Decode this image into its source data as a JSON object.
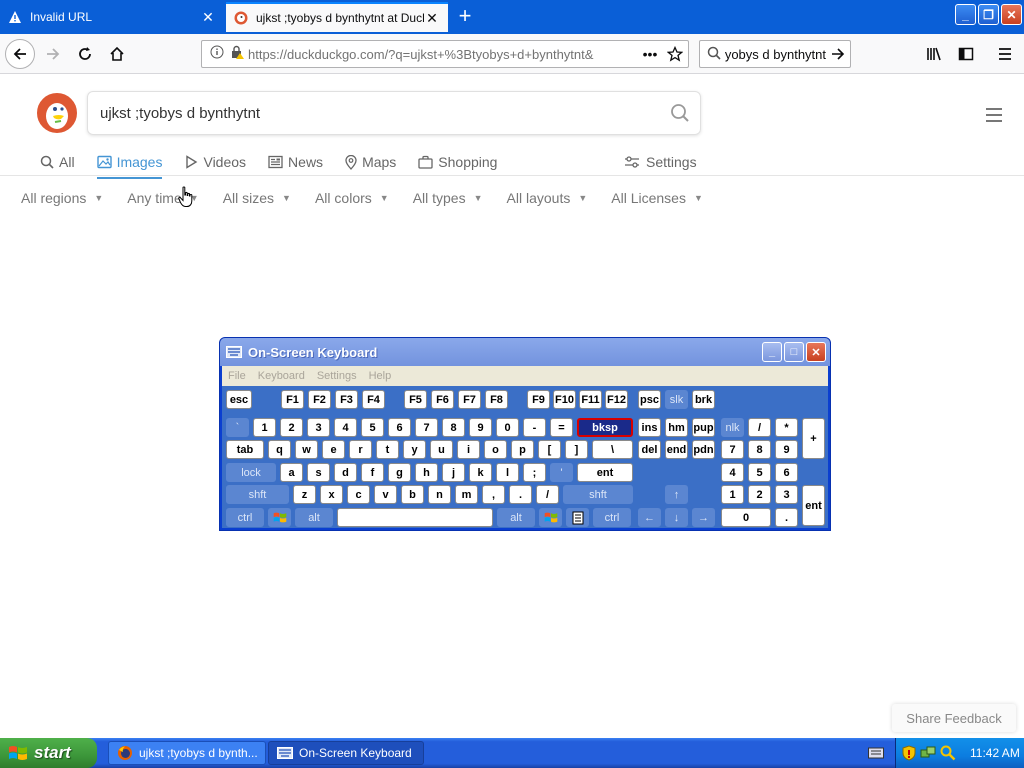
{
  "browser": {
    "tabs": [
      {
        "title": "Invalid URL",
        "active": false
      },
      {
        "title": "ujkst ;tyobys d bynthytnt at DuckDuckGo",
        "active": true
      }
    ],
    "url": "https://duckduckgo.com/?q=ujkst+%3Btyobys+d+bynthytnt&",
    "search_text": "ujkst ;tyobys d bynthytnt"
  },
  "ddg": {
    "query": "ujkst ;tyobys d bynthytnt",
    "tabs": [
      {
        "label": "All",
        "icon": "search-icon"
      },
      {
        "label": "Images",
        "icon": "image-icon"
      },
      {
        "label": "Videos",
        "icon": "play-icon"
      },
      {
        "label": "News",
        "icon": "news-icon"
      },
      {
        "label": "Maps",
        "icon": "map-pin-icon"
      },
      {
        "label": "Shopping",
        "icon": "bag-icon"
      }
    ],
    "active_tab": "Images",
    "settings_label": "Settings",
    "filters": [
      "All regions",
      "Any time",
      "All sizes",
      "All colors",
      "All types",
      "All layouts",
      "All Licenses"
    ],
    "feedback_label": "Share Feedback"
  },
  "osk": {
    "title": "On-Screen Keyboard",
    "menu": [
      "File",
      "Keyboard",
      "Settings",
      "Help"
    ],
    "keys": {
      "esc": "esc",
      "f1": "F1",
      "f2": "F2",
      "f3": "F3",
      "f4": "F4",
      "f5": "F5",
      "f6": "F6",
      "f7": "F7",
      "f8": "F8",
      "f9": "F9",
      "f10": "F10",
      "f11": "F11",
      "f12": "F12",
      "psc": "psc",
      "slk": "slk",
      "brk": "brk",
      "backtick": "`",
      "k1": "1",
      "k2": "2",
      "k3": "3",
      "k4": "4",
      "k5": "5",
      "k6": "6",
      "k7": "7",
      "k8": "8",
      "k9": "9",
      "k0": "0",
      "minus": "-",
      "equals": "=",
      "bksp": "bksp",
      "ins": "ins",
      "hm": "hm",
      "pup": "pup",
      "nlk": "nlk",
      "npdiv": "/",
      "npmul": "*",
      "npsub": "-",
      "tab": "tab",
      "q": "q",
      "w": "w",
      "e": "e",
      "r": "r",
      "t": "t",
      "y": "y",
      "u": "u",
      "i": "i",
      "o": "o",
      "p": "p",
      "lbr": "[",
      "rbr": "]",
      "bslash": "\\",
      "del": "del",
      "end": "end",
      "pdn": "pdn",
      "np7": "7",
      "np8": "8",
      "np9": "9",
      "npadd": "+",
      "lock": "lock",
      "a": "a",
      "s": "s",
      "d": "d",
      "f": "f",
      "g": "g",
      "h": "h",
      "j": "j",
      "k": "k",
      "l": "l",
      "semi": ";",
      "quote": "'",
      "ent": "ent",
      "np4": "4",
      "np5": "5",
      "np6": "6",
      "lshift": "shft",
      "z": "z",
      "x": "x",
      "c": "c",
      "v": "v",
      "b": "b",
      "n": "n",
      "m": "m",
      "comma": ",",
      "period": ".",
      "slash": "/",
      "rshift": "shft",
      "up": "↑",
      "np1": "1",
      "np2": "2",
      "np3": "3",
      "npent": "ent",
      "lctrl": "ctrl",
      "lalt": "alt",
      "ralt": "alt",
      "rctrl": "ctrl",
      "left": "←",
      "down": "↓",
      "right": "→",
      "np0": "0",
      "npdot": "."
    }
  },
  "taskbar": {
    "start_label": "start",
    "tasks": [
      {
        "label": "ujkst ;tyobys d bynth...",
        "icon": "firefox-icon"
      },
      {
        "label": "On-Screen Keyboard",
        "icon": "keyboard-icon"
      }
    ],
    "clock": "11:42 AM"
  },
  "colors": {
    "xp_blue": "#245edb",
    "ddg_orange": "#de5833",
    "active_tab": "#4495d4",
    "start_green": "#3c963a"
  }
}
